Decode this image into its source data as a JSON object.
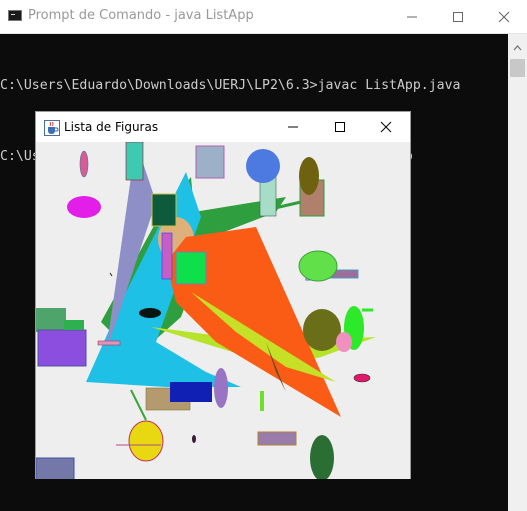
{
  "console": {
    "title": "Prompt de Comando - java  ListApp",
    "lines": [
      "C:\\Users\\Eduardo\\Downloads\\UERJ\\LP2\\6.3>javac ListApp.java",
      "C:\\Users\\Eduardo\\Downloads\\UERJ\\LP2\\6.3>java ListApp"
    ],
    "window_buttons": [
      "minimize-icon",
      "maximize-icon",
      "close-icon"
    ]
  },
  "java_window": {
    "title": "Lista de Figuras",
    "icon": "java-cup-icon",
    "window_buttons": [
      "minimize-icon",
      "maximize-icon",
      "close-icon"
    ]
  },
  "colors": {
    "console_bg": "#0c0c0c",
    "console_text": "#cccccc",
    "canvas_bg": "#eeeeee"
  }
}
